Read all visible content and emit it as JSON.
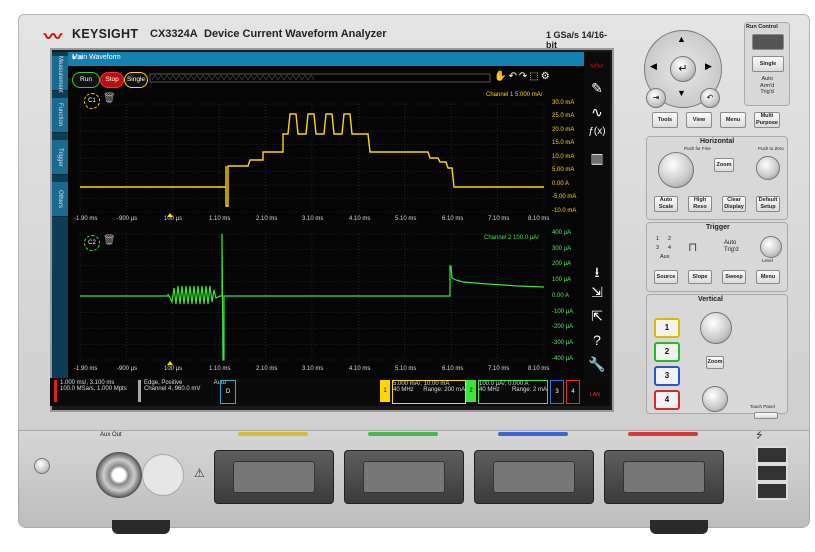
{
  "header": {
    "brand": "KEYSIGHT",
    "model": "CX3324A",
    "product_name": "Device Current Waveform Analyzer",
    "sample_spec": "1 GSa/s  14/16-bit"
  },
  "screen": {
    "window_title": "Main Waveform",
    "side_tabs": [
      "Measurement",
      "Function",
      "Trigger",
      "Others"
    ],
    "run_label": "Run",
    "stop_label": "Stop",
    "single_label": "Single",
    "channel1": {
      "badge": "C1",
      "scale_text": "Channel 1  5.000 mA/",
      "color": "#ffd700",
      "y_ticks": [
        "30.0 mA",
        "25.0 mA",
        "20.0 mA",
        "15.0 mA",
        "10.0 mA",
        "5.00 mA",
        "0.00 A",
        "-5.00 mA",
        "-10.0 mA"
      ]
    },
    "channel2": {
      "badge": "C2",
      "scale_text": "Channel 2  100.0 µA/",
      "color": "#39e639",
      "y_ticks": [
        "400 µA",
        "300 µA",
        "200 µA",
        "100 µA",
        "0.00 A",
        "-100 µA",
        "-200 µA",
        "-300 µA",
        "-400 µA"
      ]
    },
    "x_ticks": [
      "-1.90 ms",
      "-900 µs",
      "100 µs",
      "1.10 ms",
      "2.10 ms",
      "3.10 ms",
      "4.10 ms",
      "5.10 ms",
      "6.10 ms",
      "7.10 ms",
      "8.10 ms"
    ],
    "infobar": {
      "timebase_line1": "1.000 ms/,  3.100 ms",
      "timebase_line2": "100.0 MSa/s,  1.000 Mpts",
      "trigger_line1": "Edge, Positive",
      "trigger_mode": "Auto",
      "trigger_line2": "Channel 4, 960.0 mV",
      "d_label": "D",
      "ch1_num": "1",
      "ch1_line1": "5.000 mA/,  10.00 mA",
      "ch1_bw": "40 MHz",
      "ch1_range": "Range: 200 mA",
      "ch2_num": "2",
      "ch2_line1": "100.0 µA/,  0.000 A",
      "ch2_bw": "40 MHz",
      "ch2_range": "Range:  2 mA",
      "ch3_num": "3",
      "ch4_num": "4",
      "lan": "LAN"
    }
  },
  "front_panel": {
    "run_control_title": "Run Control",
    "single": "Single",
    "auto_armd": "Auto\nArm'd\nTrig'd",
    "buttons_row1": [
      "Tools",
      "View",
      "Menu",
      "Multi Purpose"
    ],
    "horizontal_title": "Horizontal",
    "zoom": "Zoom",
    "push_for_fine": "Push for Fine",
    "push_to_zero": "Push to Zero",
    "horizontal_buttons": [
      "Auto Scale",
      "High Reso",
      "Clear Display",
      "Default Setup"
    ],
    "trigger_title": "Trigger",
    "trigger_numbers": [
      "1",
      "2",
      "3",
      "4"
    ],
    "aux": "Aux",
    "auto_trigd": "Auto\nTrig'd",
    "level": "Level",
    "trigger_buttons": [
      "Source",
      "Slope",
      "Sweep",
      "Menu"
    ],
    "vertical_title": "Vertical",
    "channels": [
      "1",
      "2",
      "3",
      "4"
    ],
    "touch_panel": "Touch Panel",
    "aux_out": "Aux Out"
  }
}
